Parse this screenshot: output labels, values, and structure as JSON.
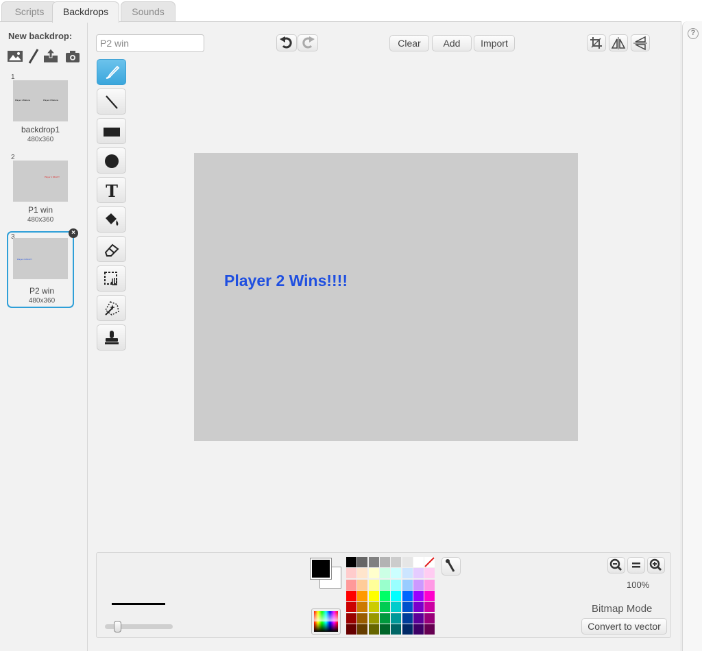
{
  "tabs": [
    {
      "label": "Scripts",
      "active": false
    },
    {
      "label": "Backdrops",
      "active": true
    },
    {
      "label": "Sounds",
      "active": false
    }
  ],
  "left": {
    "new_backdrop_label": "New backdrop:",
    "new_backdrop_icons": [
      "image-library-icon",
      "paint-brush-icon",
      "upload-icon",
      "camera-icon"
    ],
    "backdrops": [
      {
        "num": "1",
        "name": "backdrop1",
        "size": "480x360",
        "preview": [
          "Player 1 Buttons",
          "Player 2 Buttons"
        ],
        "preview_color": "#000000"
      },
      {
        "num": "2",
        "name": "P1 win",
        "size": "480x360",
        "preview": [
          "Player 1 Wins!!!!"
        ],
        "preview_color": "#e02020"
      },
      {
        "num": "3",
        "name": "P2 win",
        "size": "480x360",
        "preview": [
          "Player 2 Wins!!!!"
        ],
        "preview_color": "#1f4fe0",
        "selected": true
      }
    ]
  },
  "editor": {
    "name_value": "P2 win",
    "buttons": {
      "clear": "Clear",
      "add": "Add",
      "import": "Import"
    },
    "icons": [
      "undo-icon",
      "redo-icon",
      "crop-icon",
      "flip-horizontal-icon",
      "flip-vertical-icon"
    ],
    "tools": [
      "brush-icon",
      "line-icon",
      "rectangle-icon",
      "ellipse-icon",
      "text-icon",
      "fill-icon",
      "eraser-icon",
      "select-icon",
      "magic-select-icon",
      "stamp-icon"
    ],
    "text_tool_glyph": "T"
  },
  "canvas": {
    "background": "#cccccc",
    "text": "Player 2 Wins!!!!",
    "text_color": "#1f4fe0"
  },
  "bottom": {
    "foreground_color": "#000000",
    "background_color": "#ffffff",
    "palette": [
      [
        "#000000",
        "#666666",
        "#808080",
        "#b3b3b3",
        "#cccccc",
        "#e6e6e6",
        "#ffffff",
        "none"
      ],
      [
        "#ffcccc",
        "#ffe5cc",
        "#ffffcc",
        "#ccffe5",
        "#ccffff",
        "#cce5ff",
        "#e5ccff",
        "#ffccf2"
      ],
      [
        "#ff9999",
        "#ffcc99",
        "#ffff99",
        "#99ffcc",
        "#99ffff",
        "#99ccff",
        "#cc99ff",
        "#ff99e5"
      ],
      [
        "#ff0000",
        "#ff9900",
        "#ffff00",
        "#00ff66",
        "#00ffff",
        "#0066ff",
        "#9900ff",
        "#ff00cc"
      ],
      [
        "#cc0000",
        "#cc7a00",
        "#cccc00",
        "#00cc52",
        "#00cccc",
        "#0052cc",
        "#7a00cc",
        "#cc00a3"
      ],
      [
        "#990000",
        "#995c00",
        "#999900",
        "#00993d",
        "#009999",
        "#003d99",
        "#5c0099",
        "#99007a"
      ],
      [
        "#660000",
        "#663d00",
        "#666600",
        "#006629",
        "#006666",
        "#002966",
        "#3d0066",
        "#660052"
      ]
    ],
    "zoom_level": "100%",
    "mode_label": "Bitmap Mode",
    "convert_label": "Convert to vector",
    "brush_size_fraction": 0.15
  },
  "help_glyph": "?"
}
